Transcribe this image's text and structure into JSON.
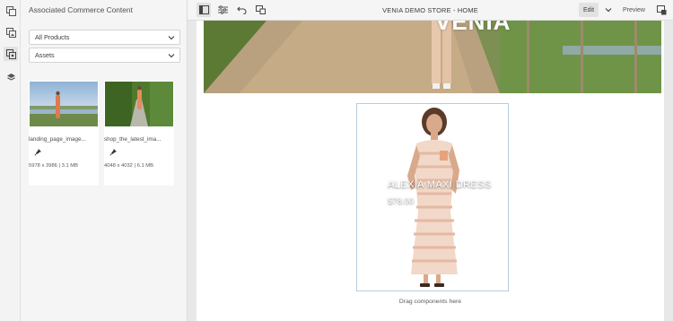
{
  "rail": {
    "items": [
      {
        "icon": "site-pages-icon"
      },
      {
        "icon": "assets-icon"
      },
      {
        "icon": "commerce-content-icon"
      },
      {
        "icon": "layers-icon"
      }
    ]
  },
  "panel": {
    "title": "Associated Commerce Content",
    "filter_product": "All Products",
    "filter_type": "Assets",
    "assets": [
      {
        "name": "landing_page_image...",
        "meta": "5978 x 3986 | 3.1 MB"
      },
      {
        "name": "shop_the_latest_ima...",
        "meta": "4048 x 4032 | 6.1 MB"
      }
    ]
  },
  "toolbar": {
    "title": "VENIA DEMO STORE - HOME",
    "edit_label": "Edit",
    "preview_label": "Preview"
  },
  "canvas": {
    "hero_text": "VENIA",
    "product_name": "ALEXIA MAXI DRESS",
    "product_price": "$78.00",
    "drop_hint": "Drag components here"
  },
  "colors": {
    "accent_border": "#b7cde0",
    "panel_bg": "#f5f5f5"
  }
}
